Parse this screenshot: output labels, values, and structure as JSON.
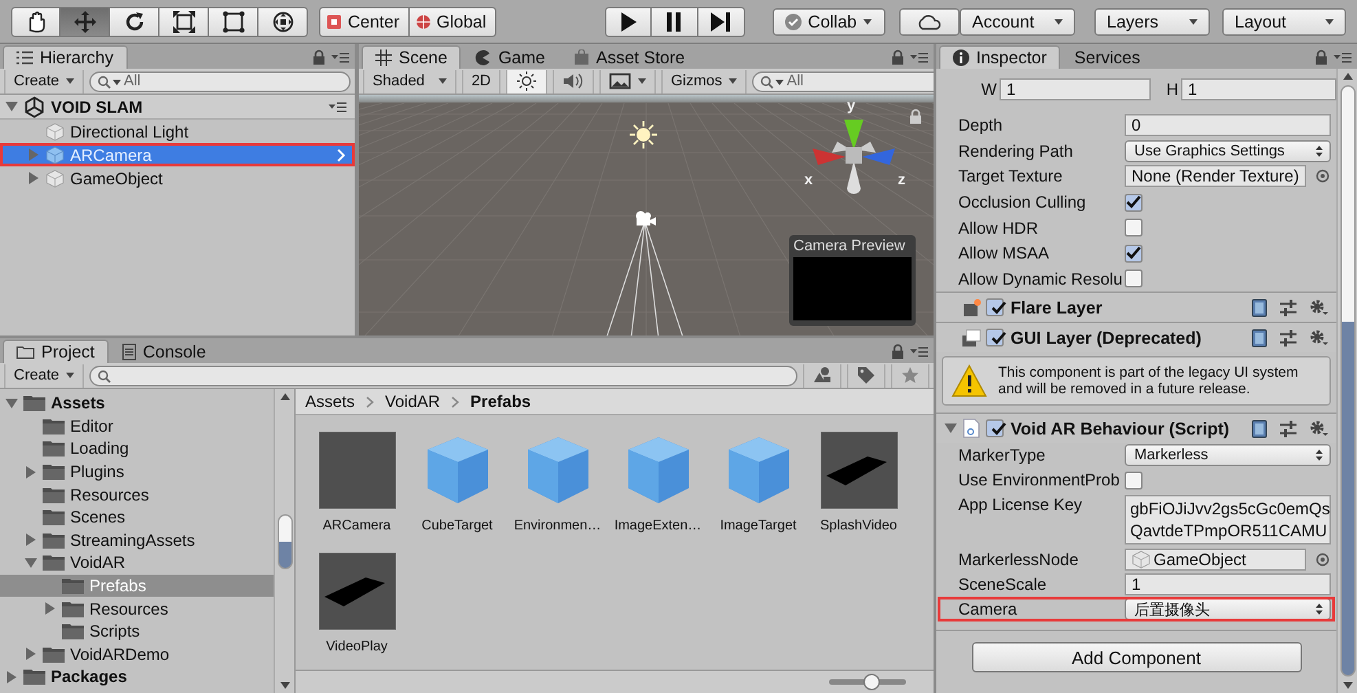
{
  "toolbar": {
    "tools": [
      {
        "kind": "hand",
        "selected": false
      },
      {
        "kind": "move",
        "selected": true
      },
      {
        "kind": "rotate",
        "selected": false
      },
      {
        "kind": "scale",
        "selected": false
      },
      {
        "kind": "rect",
        "selected": false
      },
      {
        "kind": "transform",
        "selected": false
      }
    ],
    "pivot_buttons": [
      {
        "kind": "pivot",
        "label": "Center"
      },
      {
        "kind": "space",
        "label": "Global"
      }
    ],
    "play_buttons": [
      {
        "kind": "play",
        "selected": false
      },
      {
        "kind": "pause",
        "selected": false
      },
      {
        "kind": "step",
        "selected": false
      }
    ],
    "collab": "Collab",
    "account": "Account",
    "layers": "Layers",
    "layout": "Layout"
  },
  "hierarchy": {
    "tabs": [
      {
        "label": "Hierarchy",
        "selected": true
      }
    ],
    "create": "Create",
    "search_placeholder": "All",
    "scene": {
      "name": "VOID SLAM",
      "expanded": true,
      "children": [
        {
          "name": "Directional Light",
          "selected": false,
          "highlighted": false
        },
        {
          "name": "ARCamera",
          "expanded": false,
          "selected": true,
          "highlighted": true
        },
        {
          "name": "GameObject",
          "expanded": false,
          "selected": false,
          "highlighted": false
        }
      ]
    }
  },
  "scene": {
    "tabs": [
      {
        "kind": "scene",
        "label": "Scene",
        "selected": true
      },
      {
        "kind": "game",
        "label": "Game",
        "selected": false
      },
      {
        "kind": "store",
        "label": "Asset Store",
        "selected": false
      }
    ],
    "shading": "Shaded",
    "mode_2d": {
      "label": "2D",
      "selected": false
    },
    "toggles": [
      {
        "kind": "light",
        "selected": true
      },
      {
        "kind": "audio",
        "selected": false
      },
      {
        "kind": "effects",
        "selected": false
      }
    ],
    "gizmos": "Gizmos",
    "search_placeholder": "All",
    "axes": {
      "y": "y",
      "x": "x",
      "z": "z"
    },
    "preview_title": "Camera Preview"
  },
  "inspector": {
    "tabs": [
      {
        "kind": "info",
        "label": "Inspector",
        "selected": true
      },
      {
        "kind": "plain",
        "label": "Services",
        "selected": false
      }
    ],
    "rect_row": [
      {
        "label": "W",
        "value": "1"
      },
      {
        "label": "H",
        "value": "1"
      }
    ],
    "fields": [
      {
        "kind": "text",
        "label": "Depth",
        "value": "0"
      },
      {
        "kind": "popup",
        "label": "Rendering Path",
        "value": "Use Graphics Settings"
      },
      {
        "kind": "object",
        "label": "Target Texture",
        "value": "None (Render Texture)"
      },
      {
        "kind": "check",
        "label": "Occlusion Culling",
        "checked": true
      },
      {
        "kind": "check",
        "label": "Allow HDR",
        "checked": false
      },
      {
        "kind": "check",
        "label": "Allow MSAA",
        "checked": true
      },
      {
        "kind": "check",
        "label": "Allow Dynamic Resolu",
        "checked": false
      }
    ],
    "components": [
      {
        "kind": "flare",
        "title": "Flare Layer",
        "enabled": true
      },
      {
        "kind": "gui",
        "title": "GUI Layer (Deprecated)",
        "enabled": true,
        "warning": "This component is part of the legacy UI system and will be removed in a future release."
      },
      {
        "kind": "script",
        "title": "Void AR Behaviour (Script)",
        "enabled": true,
        "expanded": true,
        "fields": [
          {
            "kind": "popup",
            "label": "MarkerType",
            "value": "Markerless",
            "highlighted": false
          },
          {
            "kind": "check",
            "label": "Use EnvironmentProb",
            "checked": false,
            "highlighted": false
          },
          {
            "kind": "textarea",
            "label": "App License Key",
            "lines": [
              "gbFiOJiJvv2gs5cGc0emQs",
              "QavtdeTPmpOR511CAMU"
            ],
            "highlighted": false
          },
          {
            "kind": "object",
            "label": "MarkerlessNode",
            "value": "GameObject",
            "highlighted": false
          },
          {
            "kind": "text",
            "label": "SceneScale",
            "value": "1",
            "highlighted": false
          },
          {
            "kind": "popup",
            "label": "Camera",
            "value": "后置摄像头",
            "highlighted": true
          }
        ]
      }
    ],
    "add_button": "Add Component"
  },
  "project": {
    "tabs": [
      {
        "kind": "folder",
        "label": "Project",
        "selected": true
      },
      {
        "kind": "console",
        "label": "Console",
        "selected": false
      }
    ],
    "create": "Create",
    "tree": [
      {
        "name": "Assets",
        "bold": true,
        "expanded": true,
        "selected": false,
        "children": [
          {
            "name": "Editor",
            "selected": false
          },
          {
            "name": "Loading",
            "selected": false
          },
          {
            "name": "Plugins",
            "expanded": false,
            "selected": false
          },
          {
            "name": "Resources",
            "selected": false
          },
          {
            "name": "Scenes",
            "selected": false
          },
          {
            "name": "StreamingAssets",
            "expanded": false,
            "selected": false
          },
          {
            "name": "VoidAR",
            "expanded": true,
            "selected": false,
            "children": [
              {
                "name": "Prefabs",
                "selected": true
              },
              {
                "name": "Resources",
                "expanded": false,
                "selected": false
              },
              {
                "name": "Scripts",
                "selected": false
              }
            ]
          },
          {
            "name": "VoidARDemo",
            "expanded": false,
            "selected": false
          }
        ]
      },
      {
        "name": "Packages",
        "bold": true,
        "expanded": false,
        "selected": false
      }
    ],
    "breadcrumb": [
      "Assets",
      "VoidAR",
      "Prefabs"
    ],
    "assets": [
      {
        "kind": "empty",
        "name": "ARCamera"
      },
      {
        "kind": "cube",
        "name": "CubeTarget"
      },
      {
        "kind": "cube",
        "name": "Environmen…"
      },
      {
        "kind": "cube",
        "name": "ImageExten…"
      },
      {
        "kind": "cube",
        "name": "ImageTarget"
      },
      {
        "kind": "plane",
        "name": "SplashVideo"
      },
      {
        "kind": "plane",
        "name": "VideoPlay"
      }
    ],
    "zoom": {
      "level": 0.55
    }
  }
}
